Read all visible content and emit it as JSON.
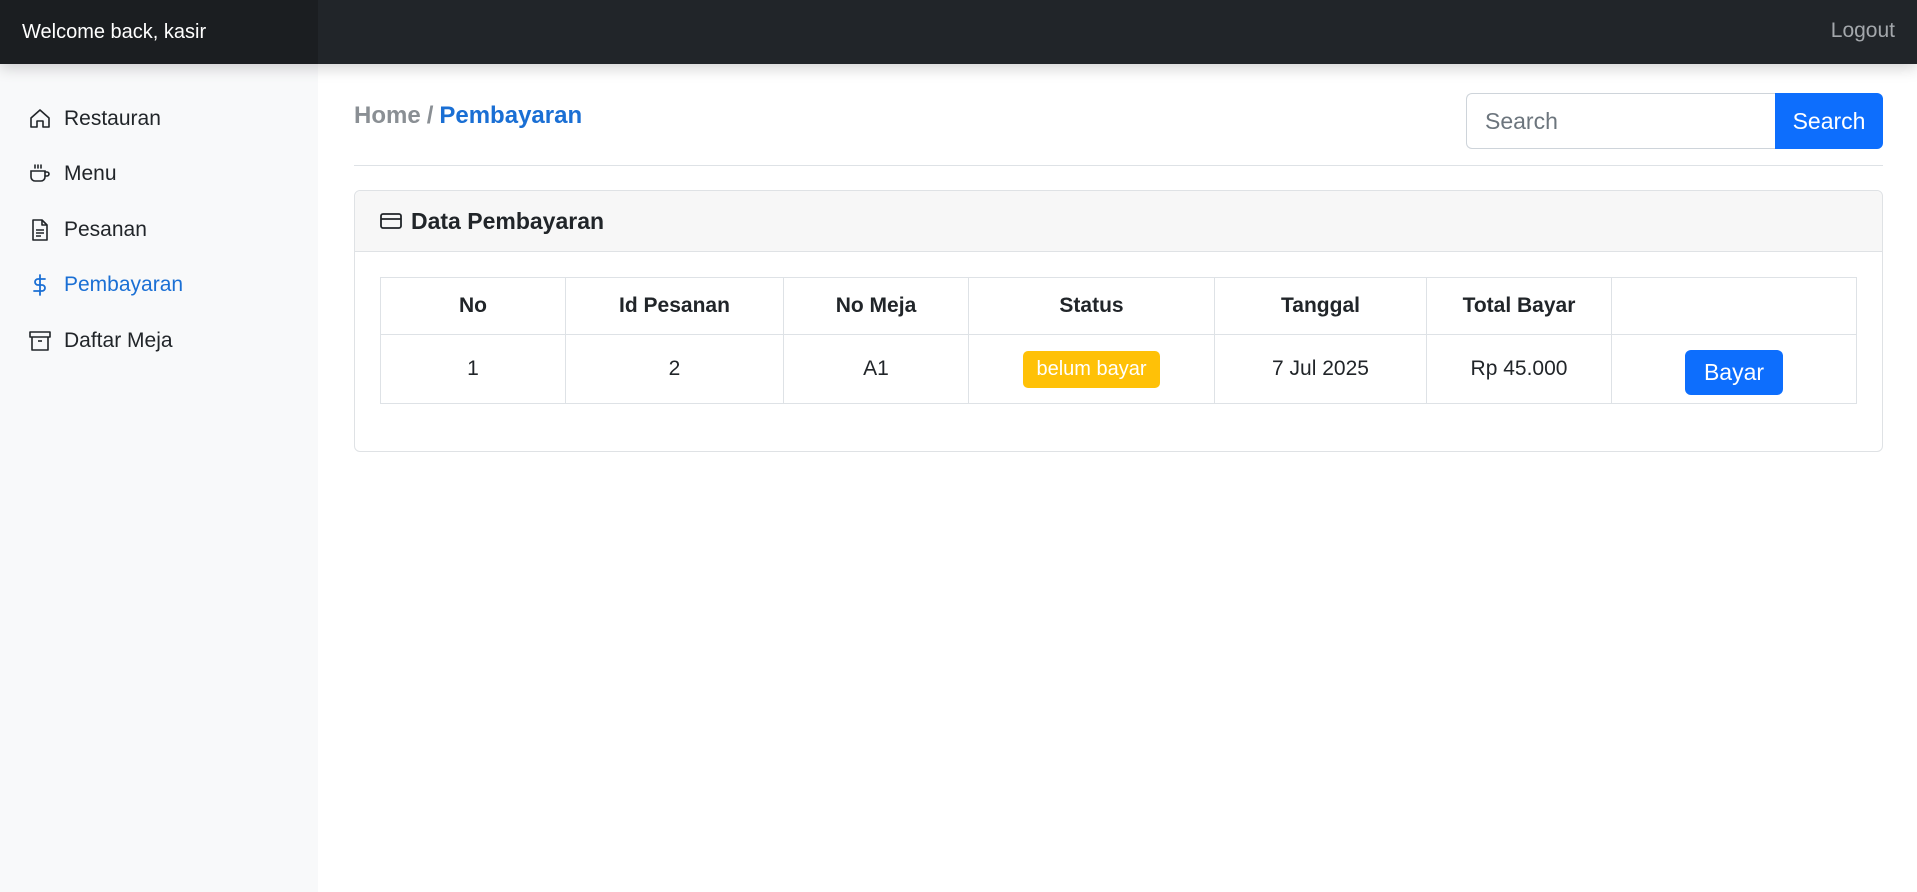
{
  "header": {
    "welcome": "Welcome back, kasir",
    "logout_label": "Logout"
  },
  "sidebar": {
    "items": [
      {
        "label": "Restauran",
        "icon": "house-icon",
        "active": false
      },
      {
        "label": "Menu",
        "icon": "cup-icon",
        "active": false
      },
      {
        "label": "Pesanan",
        "icon": "file-text-icon",
        "active": false
      },
      {
        "label": "Pembayaran",
        "icon": "dollar-icon",
        "active": true
      },
      {
        "label": "Daftar Meja",
        "icon": "archive-icon",
        "active": false
      }
    ]
  },
  "breadcrumb": {
    "home": "Home",
    "separator": "/",
    "current": "Pembayaran"
  },
  "search": {
    "placeholder": "Search",
    "value": "",
    "button_label": "Search"
  },
  "card": {
    "title": "Data Pembayaran",
    "icon": "credit-card-icon"
  },
  "table": {
    "headers": [
      "No",
      "Id Pesanan",
      "No Meja",
      "Status",
      "Tanggal",
      "Total Bayar",
      ""
    ],
    "rows": [
      {
        "no": "1",
        "id_pesanan": "2",
        "no_meja": "A1",
        "status": "belum bayar",
        "tanggal": "7 Jul 2025",
        "total_bayar": "Rp 45.000",
        "action_label": "Bayar"
      }
    ]
  },
  "colors": {
    "topbar": "#212529",
    "accent": "#0d6efd",
    "active_link": "#1a6fd4",
    "warning_badge": "#ffc107"
  }
}
